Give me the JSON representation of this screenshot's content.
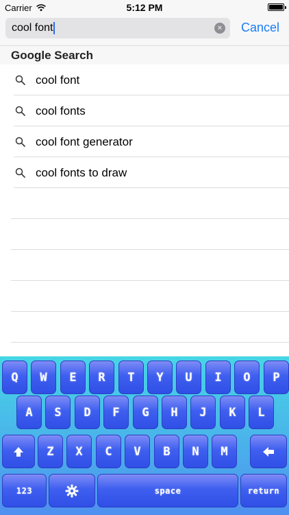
{
  "status_bar": {
    "carrier": "Carrier",
    "time": "5:12 PM"
  },
  "search": {
    "query": "cool font",
    "cancel_label": "Cancel",
    "clear_icon": "×"
  },
  "section_header": "Google Search",
  "suggestions": [
    {
      "text": "cool font",
      "icon": "search-icon"
    },
    {
      "text": "cool fonts",
      "icon": "search-icon"
    },
    {
      "text": "cool font generator",
      "icon": "search-icon"
    },
    {
      "text": "cool fonts to draw",
      "icon": "search-icon"
    }
  ],
  "keyboard": {
    "row1": [
      "Q",
      "W",
      "E",
      "R",
      "T",
      "Y",
      "U",
      "I",
      "O",
      "P"
    ],
    "row2": [
      "A",
      "S",
      "D",
      "F",
      "G",
      "H",
      "J",
      "K",
      "L"
    ],
    "row3": [
      "Z",
      "X",
      "C",
      "V",
      "B",
      "N",
      "M"
    ],
    "numbers_label": "123",
    "space_label": "space",
    "return_label": "return",
    "shift_icon": "shift-arrow-icon",
    "delete_icon": "delete-arrow-icon",
    "settings_icon": "gear-icon"
  },
  "colors": {
    "accent": "#1a7cf5",
    "key_top": "#7f8cf5",
    "key_bottom": "#2f4fe6",
    "keyboard_top": "#46d6e6",
    "keyboard_bottom": "#4f8ff0"
  }
}
